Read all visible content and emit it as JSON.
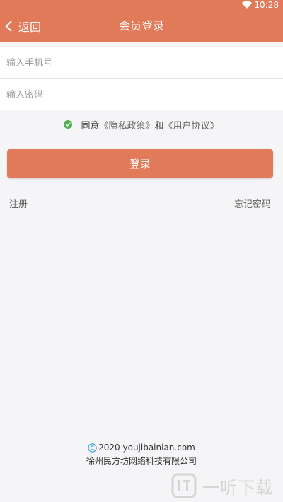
{
  "status_bar": {
    "time": "10:28",
    "icons": [
      "wifi-icon"
    ]
  },
  "header": {
    "back_label": "返回",
    "title": "会员登录",
    "back_icon": "chevron-left-icon"
  },
  "form": {
    "phone": {
      "placeholder": "输入手机号",
      "value": ""
    },
    "password": {
      "placeholder": "输入密码",
      "value": ""
    }
  },
  "agreement": {
    "checked": true,
    "check_icon": "check-circle-icon",
    "prefix": "同意",
    "privacy_link": "《隐私政策》",
    "conjunction": "和",
    "terms_link": "《用户协议》"
  },
  "login_button": {
    "label": "登录"
  },
  "links": {
    "register": "注册",
    "forgot_password": "忘记密码"
  },
  "footer": {
    "copyright_icon": "copyright-icon",
    "copyright": "2020 youjibainian.com",
    "company": "徐州民方坊网络科技有限公司"
  },
  "watermark": {
    "logo_icon": "yiting-logo-icon",
    "text": "一听下载"
  },
  "colors": {
    "accent": "#e07a59",
    "background": "#f5f5f7",
    "check_green": "#4caf50"
  }
}
